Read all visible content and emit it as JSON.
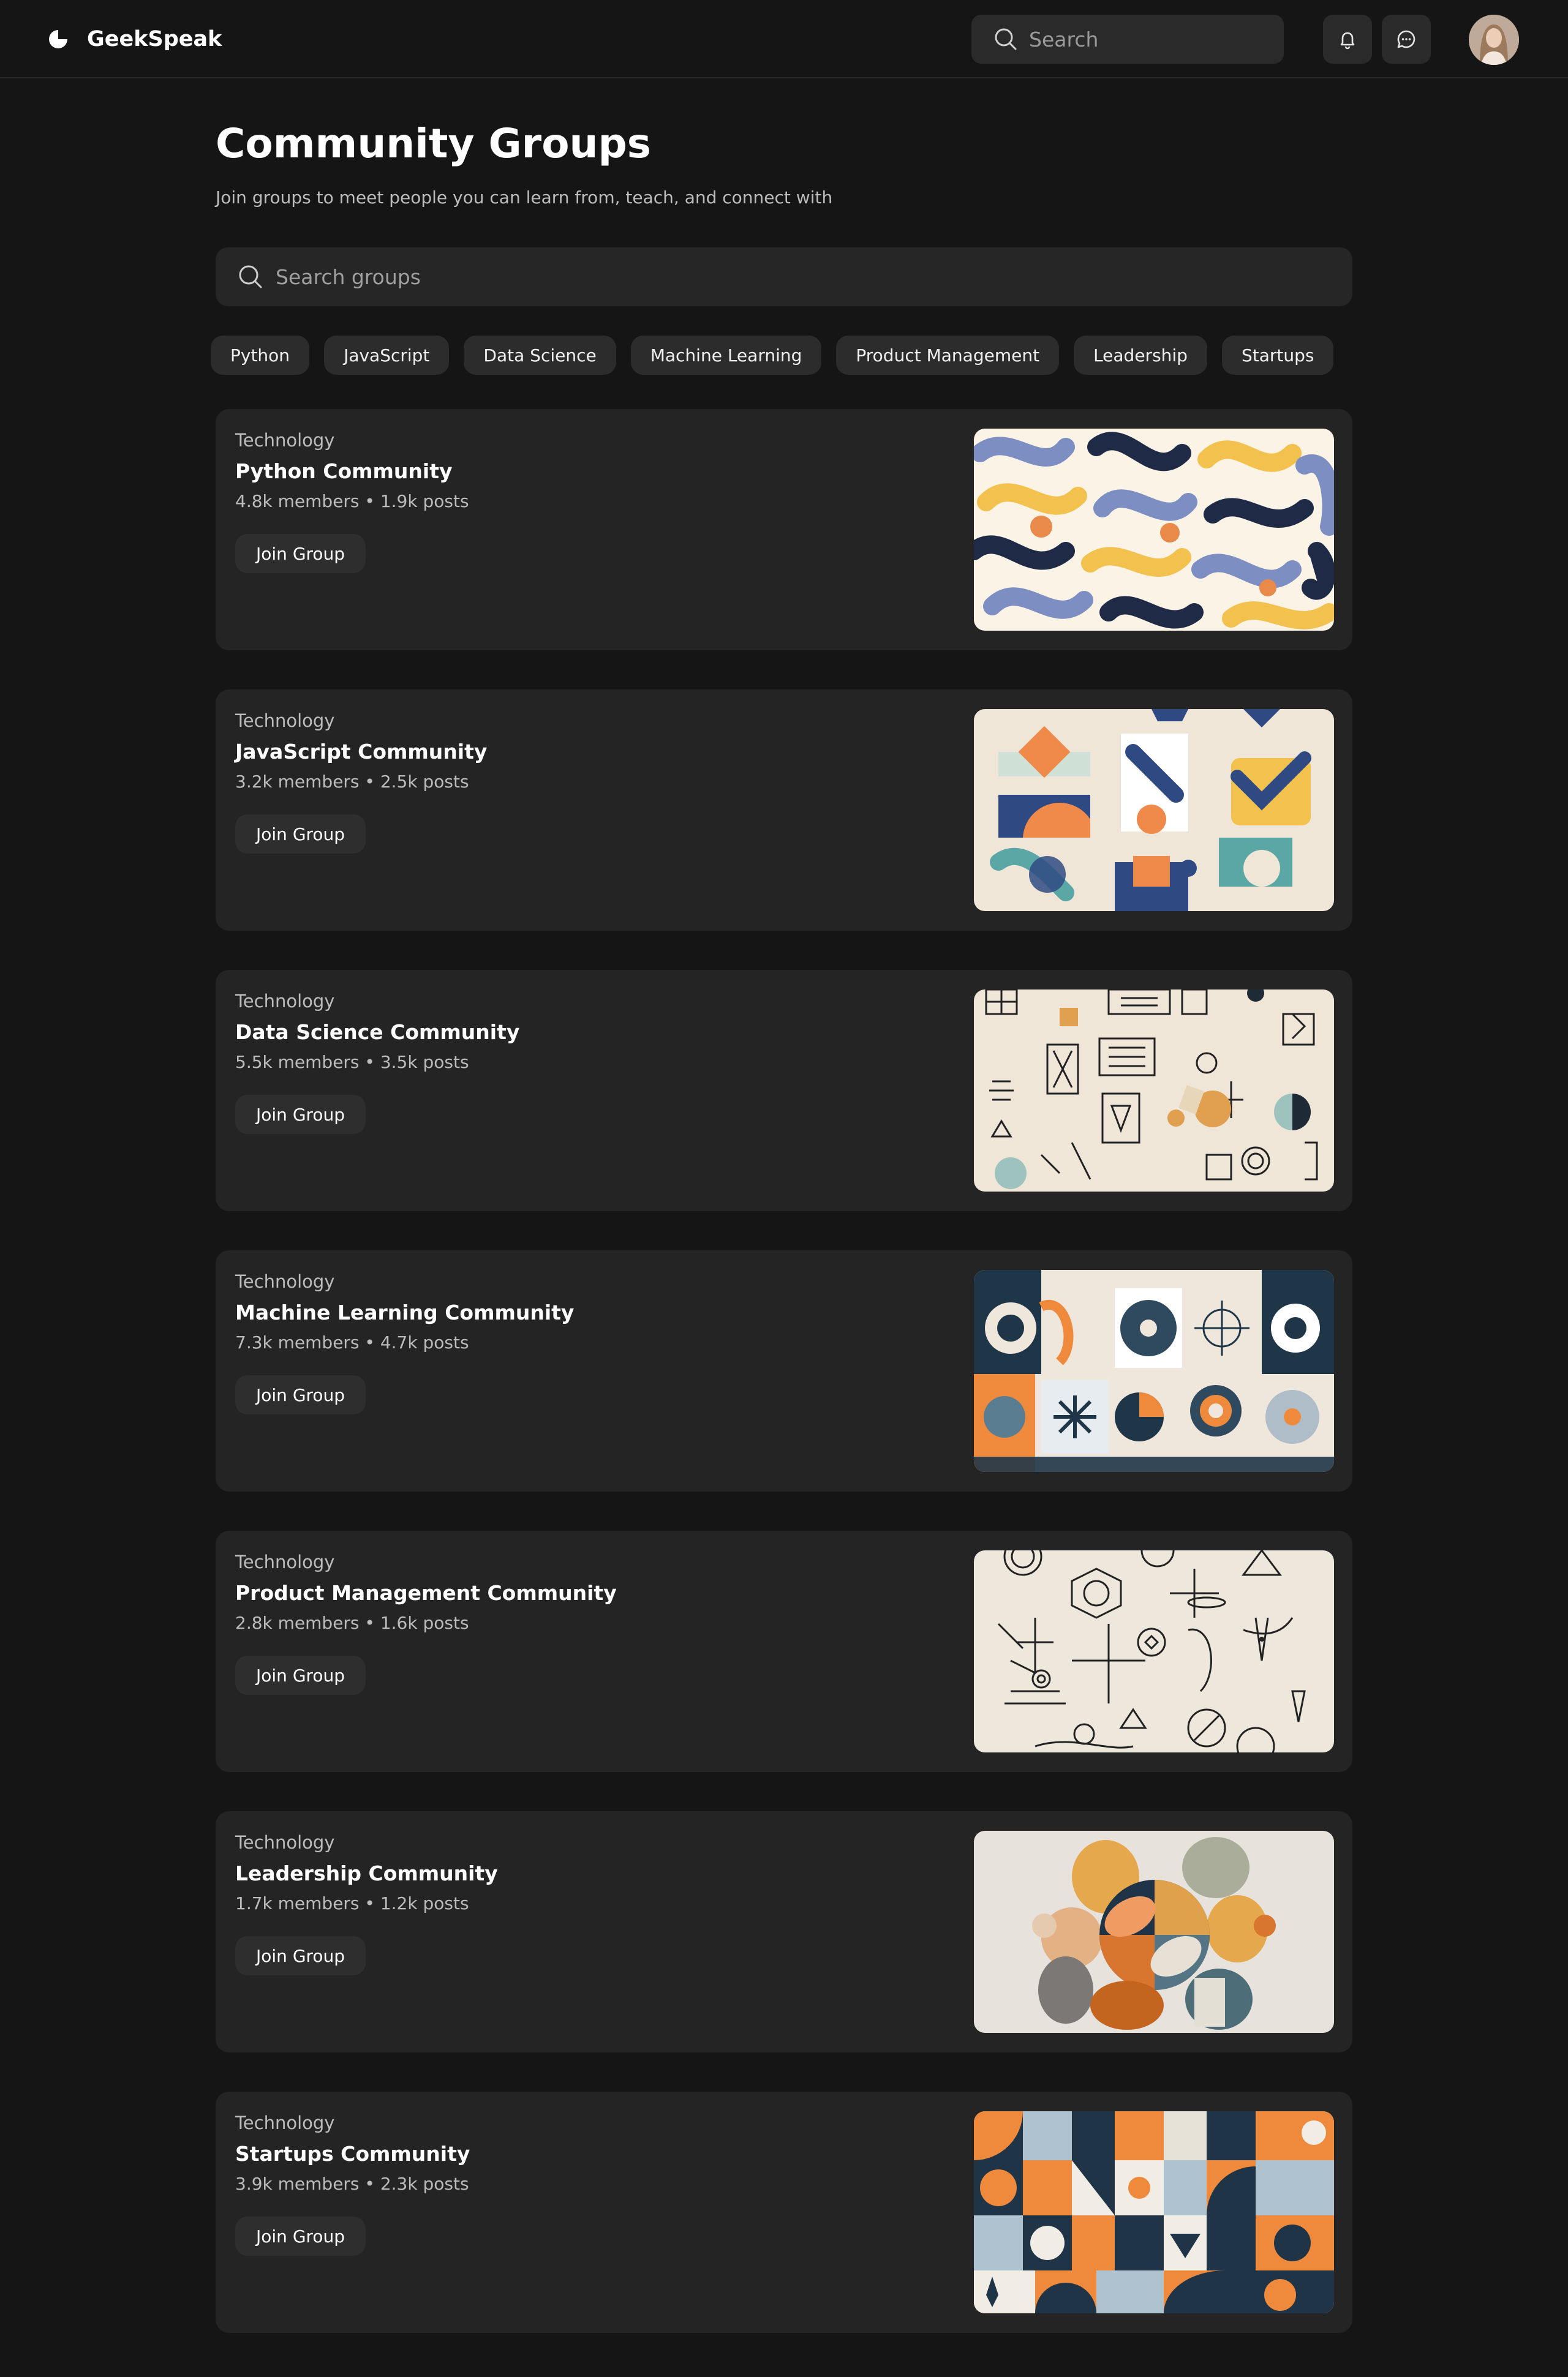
{
  "header": {
    "brand": "GeekSpeak",
    "search_placeholder": "Search"
  },
  "page": {
    "title": "Community Groups",
    "subtitle": "Join groups to meet people you can learn from, teach, and connect with",
    "search_placeholder": "Search groups"
  },
  "filters": [
    "Python",
    "JavaScript",
    "Data Science",
    "Machine Learning",
    "Product Management",
    "Leadership",
    "Startups"
  ],
  "groups": [
    {
      "category": "Technology",
      "name": "Python Community",
      "stats": "4.8k members • 1.9k posts",
      "button": "Join Group",
      "art": "python-pattern"
    },
    {
      "category": "Technology",
      "name": "JavaScript Community",
      "stats": "3.2k members • 2.5k posts",
      "button": "Join Group",
      "art": "javascript-pattern"
    },
    {
      "category": "Technology",
      "name": "Data Science Community",
      "stats": "5.5k members • 3.5k posts",
      "button": "Join Group",
      "art": "data-science-pattern"
    },
    {
      "category": "Technology",
      "name": "Machine Learning Community",
      "stats": "7.3k members • 4.7k posts",
      "button": "Join Group",
      "art": "machine-learning-pattern"
    },
    {
      "category": "Technology",
      "name": "Product Management Community",
      "stats": "2.8k members • 1.6k posts",
      "button": "Join Group",
      "art": "product-management-pattern"
    },
    {
      "category": "Technology",
      "name": "Leadership Community",
      "stats": "1.7k members • 1.2k posts",
      "button": "Join Group",
      "art": "leadership-pattern"
    },
    {
      "category": "Technology",
      "name": "Startups Community",
      "stats": "3.9k members • 2.3k posts",
      "button": "Join Group",
      "art": "startups-pattern"
    }
  ],
  "colors": {
    "background": "#151515",
    "card": "#242424",
    "chip": "#2c2c2c",
    "text": "#ffffff",
    "muted": "#bcbcbc"
  }
}
